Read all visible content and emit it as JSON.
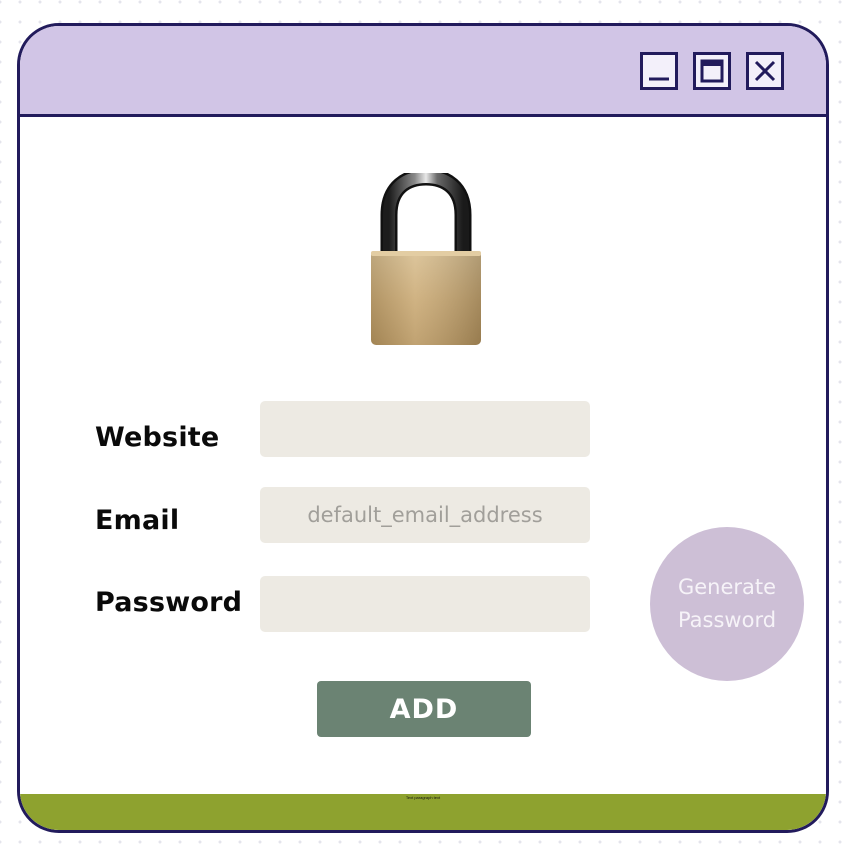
{
  "titlebar": {
    "controls": [
      {
        "name": "minimize",
        "icon": "minimize-icon"
      },
      {
        "name": "maximize",
        "icon": "maximize-icon"
      },
      {
        "name": "close",
        "icon": "close-icon"
      }
    ]
  },
  "logo": {
    "icon": "padlock-icon"
  },
  "form": {
    "website": {
      "label": "Website",
      "value": "",
      "placeholder": ""
    },
    "email": {
      "label": "Email",
      "value": "",
      "placeholder": "default_email_address"
    },
    "password": {
      "label": "Password",
      "value": "",
      "placeholder": ""
    }
  },
  "buttons": {
    "generate_label": "Generate\nPassword",
    "add_label": "ADD"
  },
  "footer": {
    "text": "Text paragraph text"
  },
  "colors": {
    "titlebar_bg": "#d1c5e6",
    "border": "#221b5c",
    "input_bg": "#edeae3",
    "generate_bg": "#cdbfd6",
    "add_bg": "#6b8373",
    "footer_bg": "#8ea22f"
  }
}
